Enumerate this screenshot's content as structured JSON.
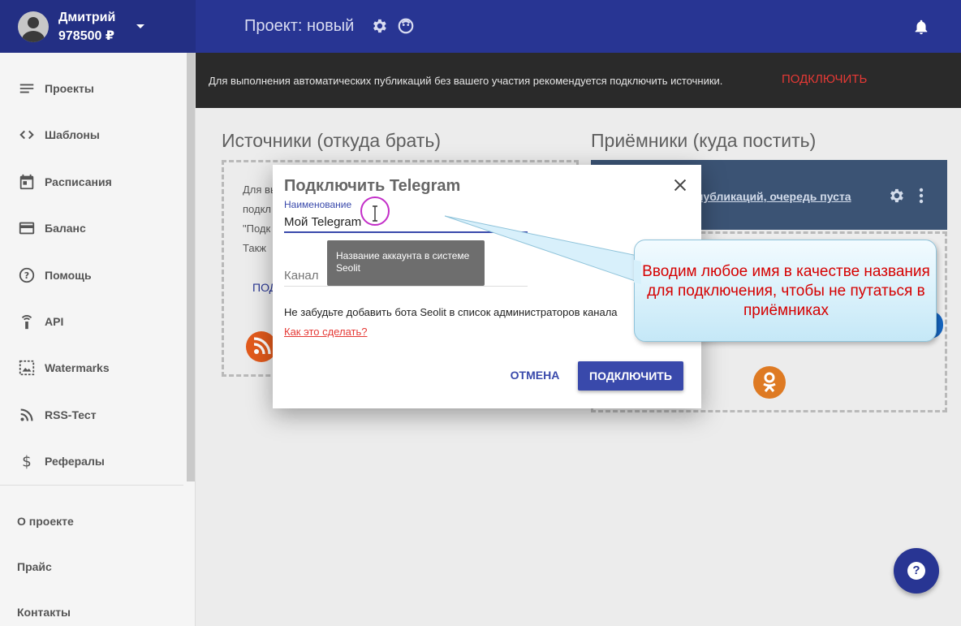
{
  "header": {
    "user_name": "Дмитрий",
    "user_balance": "978500 ₽",
    "project_title": "Проект: новый"
  },
  "sidebar": {
    "items": [
      {
        "label": "Проекты",
        "icon": "list-icon"
      },
      {
        "label": "Шаблоны",
        "icon": "code-icon"
      },
      {
        "label": "Расписания",
        "icon": "calendar-icon"
      },
      {
        "label": "Баланс",
        "icon": "credit-card-icon"
      },
      {
        "label": "Помощь",
        "icon": "help-circle-icon"
      },
      {
        "label": "API",
        "icon": "api-icon"
      },
      {
        "label": "Watermarks",
        "icon": "watermark-icon"
      },
      {
        "label": "RSS-Тест",
        "icon": "rss-icon"
      },
      {
        "label": "Рефералы",
        "icon": "dollar-icon"
      }
    ],
    "footer_links": [
      "О проекте",
      "Прайс",
      "Контакты"
    ]
  },
  "banner": {
    "text": "Для выполнения автоматических публикаций без вашего участия рекомендуется подключить источники.",
    "link": "ПОДКЛЮЧИТЬ"
  },
  "sources": {
    "title": "Источники (откуда брать)",
    "lines": [
      "Для вы",
      "подкл",
      "\"Подк",
      "Такж"
    ],
    "link": "ПОД"
  },
  "receivers": {
    "title": "Приёмники (куда постить)",
    "queue_text": "публикаций, очередь пуста"
  },
  "modal": {
    "title": "Подключить Telegram",
    "name_label": "Наименование",
    "name_value": "Мой Telegram",
    "tooltip": "Название аккаунта в системе Seolit",
    "channel_placeholder": "Канал",
    "note": "Не забудьте добавить бота Seolit в список администраторов канала",
    "howto": "Как это сделать?",
    "cancel": "ОТМЕНА",
    "connect": "ПОДКЛЮЧИТЬ"
  },
  "callout": {
    "text": "Вводим любое имя в качестве названия для подключения, чтобы не путаться в приёмниках"
  },
  "help_fab": "?",
  "colors": {
    "header": "#283593",
    "accent": "#3949ab",
    "alert": "#e53935",
    "banner": "#2a2a2a"
  }
}
